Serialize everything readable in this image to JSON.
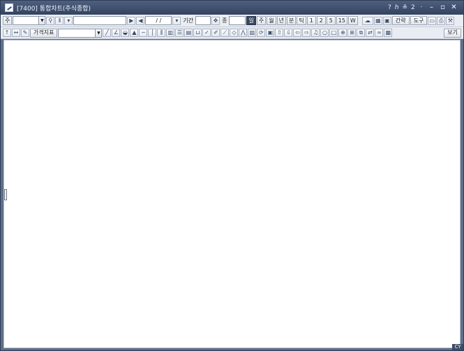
{
  "window": {
    "title": "[7400] 통합차트(주식종합)",
    "title_right": [
      "?",
      "ℎ",
      "≗",
      "2",
      "ㆍ"
    ]
  },
  "toolbar1": {
    "code_label": "주",
    "period_label": "기간",
    "date_value": "/  /",
    "unit_label": "일",
    "unit_items": [
      "일",
      "주",
      "월",
      "년",
      "분",
      "틱",
      "1",
      "2",
      "5",
      "15",
      "W"
    ],
    "right_buttons": [
      "간략",
      "도구"
    ],
    "fund_label": "종"
  },
  "toolbar2": {
    "indicator_button": "가격지표",
    "view_button": "보기"
  },
  "status": {
    "corner": "CY"
  }
}
